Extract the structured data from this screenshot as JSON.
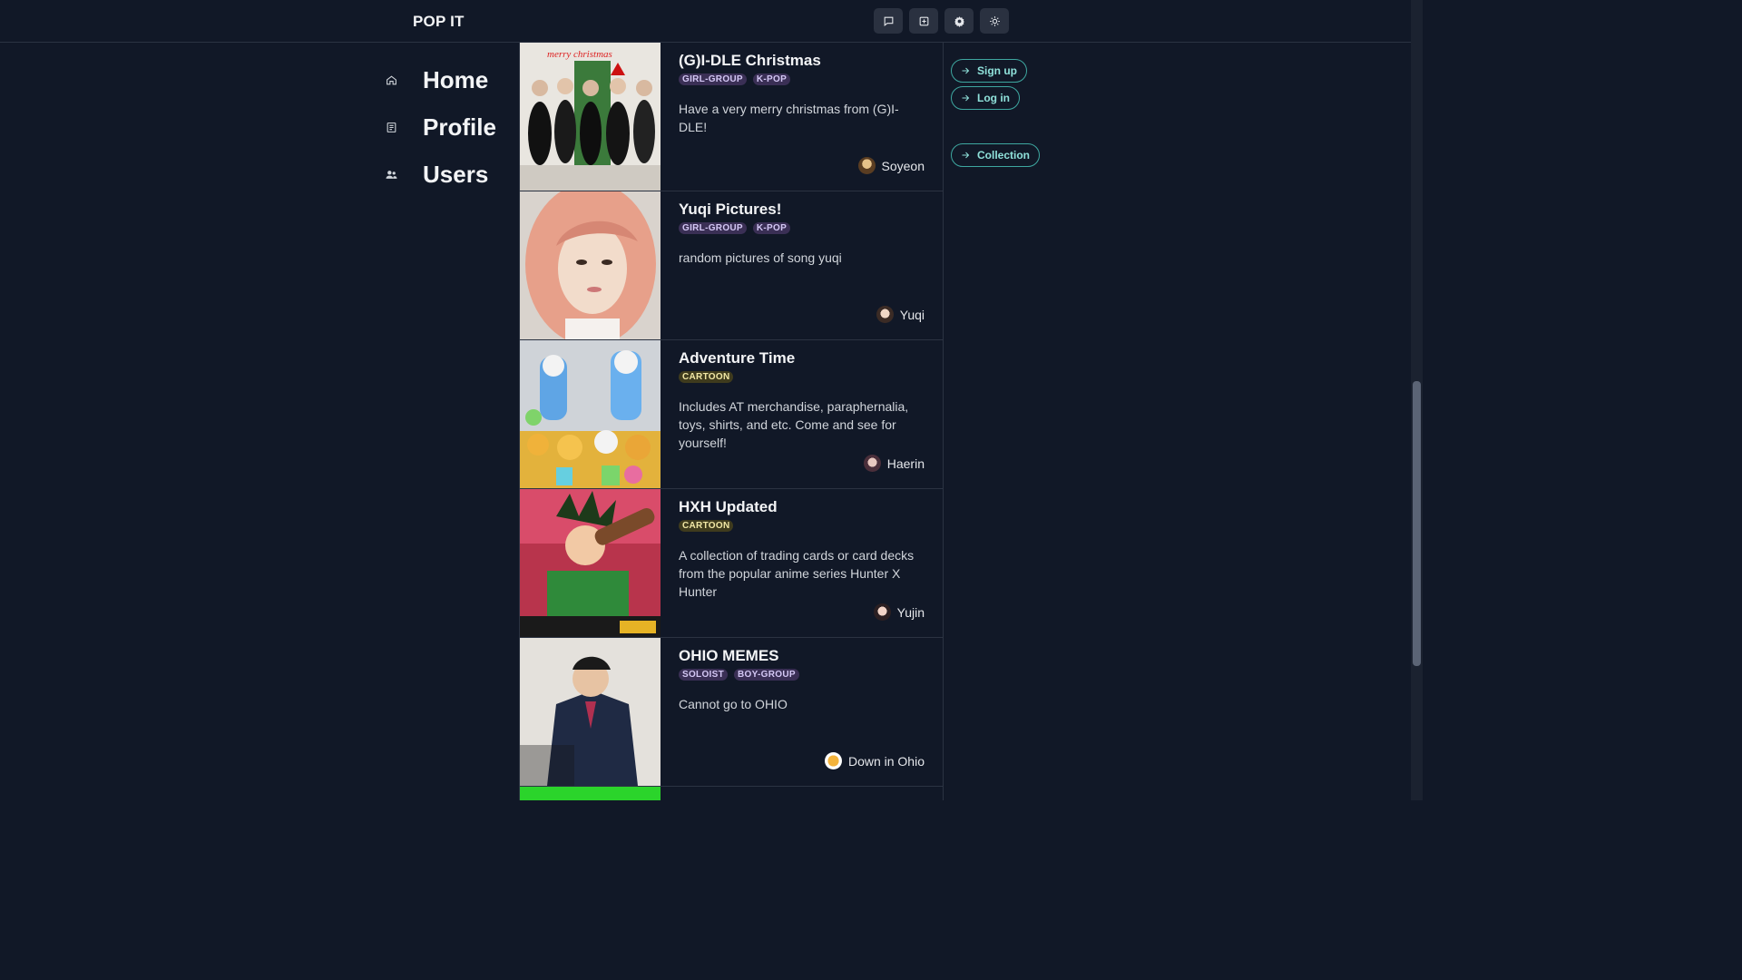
{
  "header": {
    "brand": "POP IT",
    "buttons": [
      {
        "name": "chat-bubble-icon"
      },
      {
        "name": "plus-square-icon"
      },
      {
        "name": "gear-icon"
      },
      {
        "name": "sun-icon"
      }
    ]
  },
  "nav": {
    "items": [
      {
        "label": "Home",
        "icon": "home-icon"
      },
      {
        "label": "Profile",
        "icon": "profile-icon"
      },
      {
        "label": "Users",
        "icon": "users-icon"
      }
    ]
  },
  "feed": {
    "cards": [
      {
        "title": "(G)I-DLE Christmas",
        "tags": [
          "GIRL-GROUP",
          "K-POP"
        ],
        "description": "Have a very merry christmas from (G)I-DLE!",
        "author": "Soyeon",
        "thumb_text": "merry christmas"
      },
      {
        "title": "Yuqi Pictures!",
        "tags": [
          "GIRL-GROUP",
          "K-POP"
        ],
        "description": "random pictures of song yuqi",
        "author": "Yuqi"
      },
      {
        "title": "Adventure Time",
        "tags": [
          "CARTOON"
        ],
        "description": "Includes AT merchandise, paraphernalia, toys, shirts, and etc. Come and see for yourself!",
        "author": "Haerin"
      },
      {
        "title": "HXH Updated",
        "tags": [
          "CARTOON"
        ],
        "description": "A collection of trading cards or card decks from the popular anime series Hunter X Hunter",
        "author": "Yujin"
      },
      {
        "title": "OHIO MEMES",
        "tags": [
          "SOLOIST",
          "BOY-GROUP"
        ],
        "description": "Cannot go to OHIO",
        "author": "Down in Ohio"
      }
    ]
  },
  "auth": {
    "signup_label": "Sign up",
    "login_label": "Log in",
    "collection_label": "Collection"
  },
  "colors": {
    "background": "#111827",
    "accent": "#3ea7a0",
    "tag_kpop": "#3a2f55",
    "tag_cartoon": "#3f3b1d"
  }
}
